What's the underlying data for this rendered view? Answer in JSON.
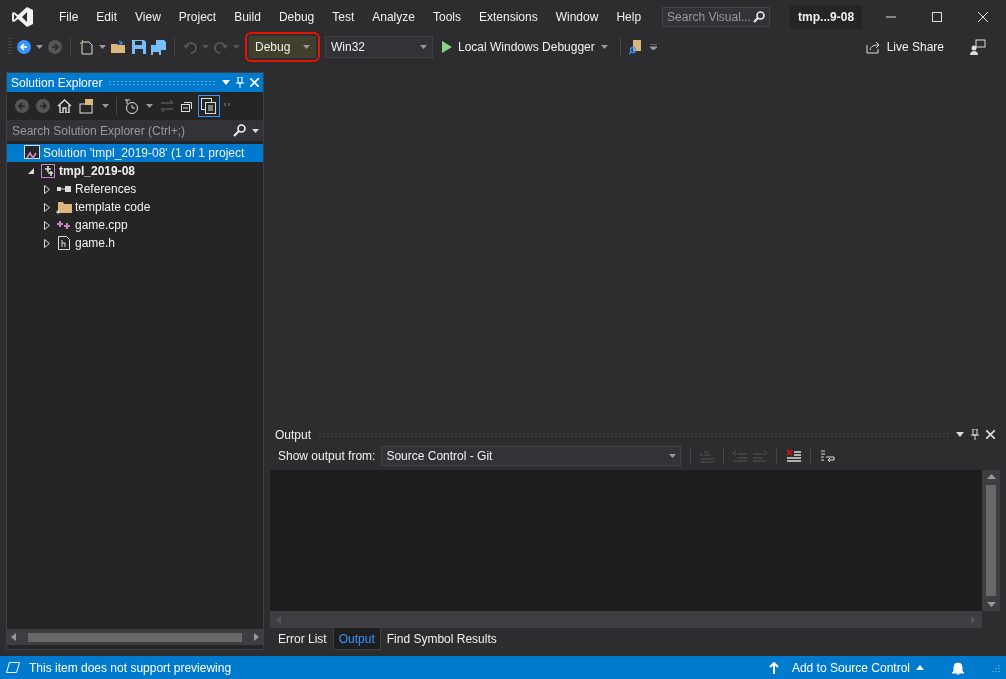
{
  "window": {
    "title": "tmp...9-08"
  },
  "menu": [
    "File",
    "Edit",
    "View",
    "Project",
    "Build",
    "Debug",
    "Test",
    "Analyze",
    "Tools",
    "Extensions",
    "Window",
    "Help"
  ],
  "search": {
    "placeholder": "Search Visual..."
  },
  "toolbar": {
    "configuration": {
      "value": "Debug",
      "highlighted": true
    },
    "platform": {
      "value": "Win32"
    },
    "debugger": "Local Windows Debugger",
    "live_share": "Live Share"
  },
  "solution_explorer": {
    "title": "Solution Explorer",
    "search": {
      "placeholder": "Search Solution Explorer (Ctrl+;)"
    },
    "tree": [
      {
        "label": "Solution 'tmpl_2019-08' (1 of 1 project",
        "kind": "solution",
        "selected": true,
        "children": [
          {
            "label": "tmpl_2019-08",
            "kind": "project",
            "selected": false,
            "expanded": true,
            "children": [
              {
                "label": "References",
                "kind": "references",
                "selected": false,
                "expanded": false
              },
              {
                "label": "template code",
                "kind": "folder",
                "selected": false,
                "expanded": false
              },
              {
                "label": "game.cpp",
                "kind": "cpp",
                "selected": false,
                "expanded": false
              },
              {
                "label": "game.h",
                "kind": "header",
                "selected": false,
                "expanded": false
              }
            ]
          }
        ]
      }
    ]
  },
  "output": {
    "title": "Output",
    "source_label": "Show output from:",
    "source": "Source Control - Git",
    "tabs": [
      {
        "label": "Error List",
        "selected": false
      },
      {
        "label": "Output",
        "selected": true
      },
      {
        "label": "Find Symbol Results",
        "selected": false
      }
    ]
  },
  "status_bar": {
    "message": "This item does not support previewing",
    "source_control": "Add to Source Control"
  }
}
